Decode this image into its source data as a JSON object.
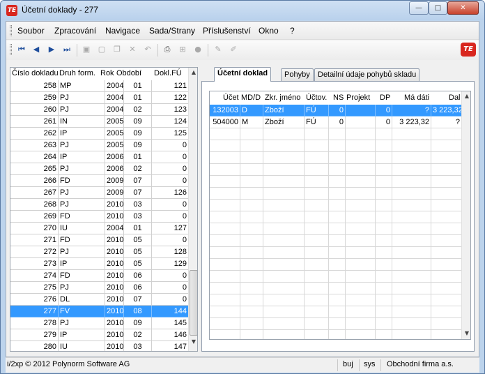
{
  "window": {
    "title": "Účetní doklady - 277",
    "app_icon": "TE",
    "min_label": "—",
    "max_label": "□",
    "close_label": "✕"
  },
  "menu": {
    "items": [
      "Soubor",
      "Zpracování",
      "Navigace",
      "Sada/Strany",
      "Příslušenství",
      "Okno",
      "?"
    ]
  },
  "toolbar": {
    "icons": [
      {
        "name": "first-record-icon",
        "glyph": "⏮",
        "enabled": true
      },
      {
        "name": "prev-record-icon",
        "glyph": "◀",
        "enabled": true
      },
      {
        "name": "next-record-icon",
        "glyph": "▶",
        "enabled": true
      },
      {
        "name": "last-record-icon",
        "glyph": "⏭",
        "enabled": true
      },
      {
        "name": "save-icon",
        "glyph": "▣",
        "enabled": false
      },
      {
        "name": "new-document-icon",
        "glyph": "▢",
        "enabled": false
      },
      {
        "name": "copy-icon",
        "glyph": "❐",
        "enabled": false
      },
      {
        "name": "delete-icon",
        "glyph": "✕",
        "enabled": false
      },
      {
        "name": "undo-icon",
        "glyph": "↶",
        "enabled": false
      },
      {
        "name": "print-icon",
        "glyph": "⎙",
        "enabled": true
      },
      {
        "name": "tree-icon",
        "glyph": "⊞",
        "enabled": false
      },
      {
        "name": "stop-icon",
        "glyph": "●",
        "enabled": false
      },
      {
        "name": "edit-icon",
        "glyph": "✎",
        "enabled": false
      },
      {
        "name": "pen-icon",
        "glyph": "✐",
        "enabled": false
      }
    ],
    "logo": "TE"
  },
  "left_grid": {
    "headers": [
      "Číslo dokladu",
      "Druh form.",
      "Rok",
      "Období",
      "Dokl.FÚ"
    ],
    "rows": [
      [
        "258",
        "MP",
        "2004",
        "01",
        "121"
      ],
      [
        "259",
        "PJ",
        "2004",
        "01",
        "122"
      ],
      [
        "260",
        "PJ",
        "2004",
        "02",
        "123"
      ],
      [
        "261",
        "IN",
        "2005",
        "09",
        "124"
      ],
      [
        "262",
        "IP",
        "2005",
        "09",
        "125"
      ],
      [
        "263",
        "PJ",
        "2005",
        "09",
        "0"
      ],
      [
        "264",
        "IP",
        "2006",
        "01",
        "0"
      ],
      [
        "265",
        "PJ",
        "2006",
        "02",
        "0"
      ],
      [
        "266",
        "FD",
        "2009",
        "07",
        "0"
      ],
      [
        "267",
        "PJ",
        "2009",
        "07",
        "126"
      ],
      [
        "268",
        "PJ",
        "2010",
        "03",
        "0"
      ],
      [
        "269",
        "FD",
        "2010",
        "03",
        "0"
      ],
      [
        "270",
        "IU",
        "2004",
        "01",
        "127"
      ],
      [
        "271",
        "FD",
        "2010",
        "05",
        "0"
      ],
      [
        "272",
        "PJ",
        "2010",
        "05",
        "128"
      ],
      [
        "273",
        "IP",
        "2010",
        "05",
        "129"
      ],
      [
        "274",
        "FD",
        "2010",
        "06",
        "0"
      ],
      [
        "275",
        "PJ",
        "2010",
        "06",
        "0"
      ],
      [
        "276",
        "DL",
        "2010",
        "07",
        "0"
      ],
      [
        "277",
        "FV",
        "2010",
        "08",
        "144"
      ],
      [
        "278",
        "PJ",
        "2010",
        "09",
        "145"
      ],
      [
        "279",
        "IP",
        "2010",
        "02",
        "146"
      ],
      [
        "280",
        "IU",
        "2010",
        "03",
        "147"
      ]
    ],
    "selected_index": 19
  },
  "tabs": [
    "Účetní doklad",
    "Pohyby",
    "Detailní údaje pohybů skladu"
  ],
  "active_tab": 0,
  "right_grid": {
    "headers": [
      "Účet",
      "MD/D",
      "Zkr. jméno",
      "Účtov.",
      "NS",
      "Projekt",
      "DP",
      "Má dáti",
      "Dal"
    ],
    "rows": [
      [
        "132003",
        "D",
        "Zboží",
        "FÚ",
        "0",
        "",
        "0",
        "?",
        "3 223,32"
      ],
      [
        "504000",
        "M",
        "Zboží",
        "FÚ",
        "0",
        "",
        "0",
        "3 223,32",
        "?"
      ]
    ],
    "selected_index": 0
  },
  "status": {
    "copyright": "i/2xp © 2012 Polynorm Software AG",
    "user": "buj",
    "system": "sys",
    "company": "Obchodní firma a.s."
  }
}
